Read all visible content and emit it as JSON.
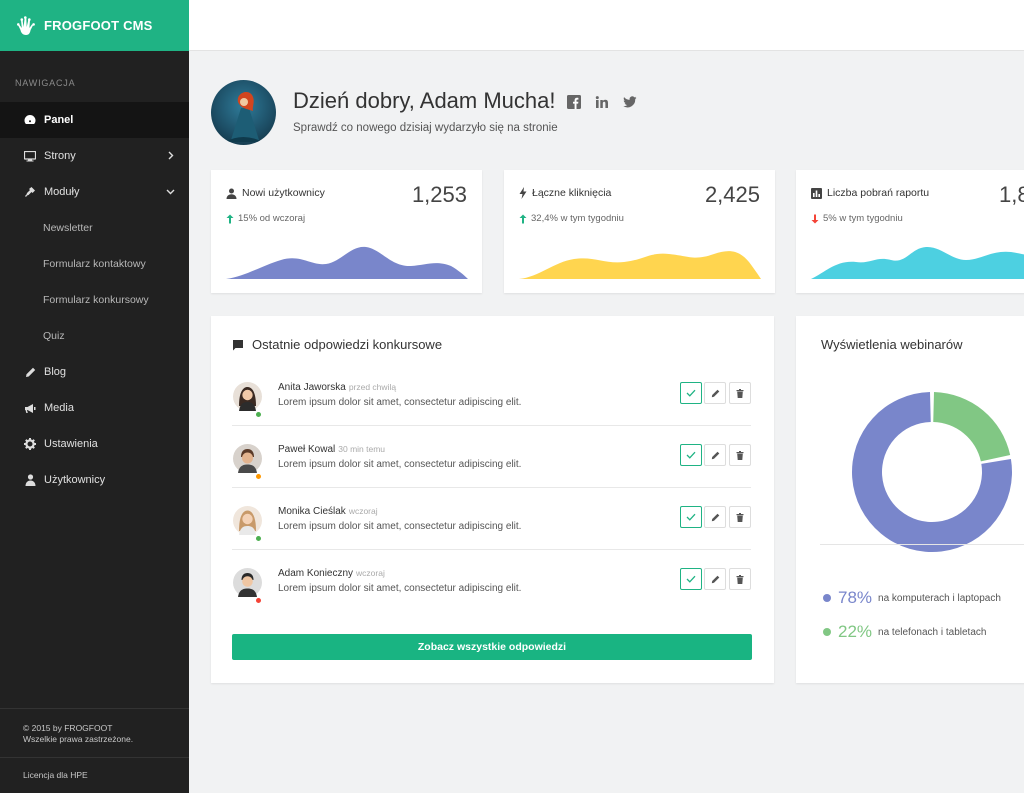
{
  "brand": {
    "name": "FROGFOOT CMS"
  },
  "nav": {
    "heading": "NAWIGACJA",
    "items": [
      {
        "label": "Panel",
        "icon": "dashboard-icon",
        "active": true
      },
      {
        "label": "Strony",
        "icon": "monitor-icon",
        "chevron": "right"
      },
      {
        "label": "Moduły",
        "icon": "plug-icon",
        "chevron": "down"
      },
      {
        "label": "Newsletter",
        "sub": true
      },
      {
        "label": "Formularz kontaktowy",
        "sub": true
      },
      {
        "label": "Formularz konkursowy",
        "sub": true
      },
      {
        "label": "Quiz",
        "sub": true
      },
      {
        "label": "Blog",
        "icon": "pencil-icon"
      },
      {
        "label": "Media",
        "icon": "megaphone-icon"
      },
      {
        "label": "Ustawienia",
        "icon": "gear-icon"
      },
      {
        "label": "Użytkownicy",
        "icon": "user-icon"
      }
    ],
    "footer": {
      "copy1": "© 2015 by FROGFOOT",
      "copy2": "Wszelkie prawa zastrzeżone.",
      "license": "Licencja dla HPE"
    }
  },
  "header": {
    "greeting": "Dzień dobry, Adam Mucha!",
    "subtitle": "Sprawdź co nowego dzisiaj wydarzyło się na stronie"
  },
  "stats": [
    {
      "title": "Nowi użytkownicy",
      "value": "1,253",
      "change": "15% od wczoraj",
      "trend": "up",
      "color": "#7986cb"
    },
    {
      "title": "Łączne kliknięcia",
      "value": "2,425",
      "change": "32,4% w tym tygodniu",
      "trend": "up",
      "color": "#ffd54f"
    },
    {
      "title": "Liczba pobrań raportu",
      "value": "1,8",
      "change": "5% w tym tygodniu",
      "trend": "down",
      "color": "#4dd0e1"
    }
  ],
  "responses": {
    "title": "Ostatnie odpowiedzi konkursowe",
    "items": [
      {
        "name": "Anita Jaworska",
        "time": "przed chwilą",
        "message": "Lorem ipsum dolor sit amet, consectetur adipiscing elit.",
        "status_color": "#4caf50"
      },
      {
        "name": "Paweł Kowal",
        "time": "30 min temu",
        "message": "Lorem ipsum dolor sit amet, consectetur adipiscing elit.",
        "status_color": "#ff9800"
      },
      {
        "name": "Monika Cieślak",
        "time": "wczoraj",
        "message": "Lorem ipsum dolor sit amet, consectetur adipiscing elit.",
        "status_color": "#4caf50"
      },
      {
        "name": "Adam Konieczny",
        "time": "wczoraj",
        "message": "Lorem ipsum dolor sit amet, consectetur adipiscing elit.",
        "status_color": "#f44336"
      }
    ],
    "cta": "Zobacz wszystkie odpowiedzi"
  },
  "webinars": {
    "title": "Wyświetlenia webinarów",
    "chart_data": {
      "type": "pie",
      "categories": [
        "na komputerach i laptopach",
        "na telefonach i tabletach"
      ],
      "values": [
        78,
        22
      ],
      "colors": [
        "#7986cb",
        "#81c784"
      ]
    },
    "legend": [
      {
        "pct": "78%",
        "label": "na komputerach i laptopach",
        "color": "#7986cb"
      },
      {
        "pct": "22%",
        "label": "na telefonach i tabletach",
        "color": "#81c784"
      }
    ]
  },
  "colors": {
    "accent": "#1fb384",
    "sidebar": "#212121"
  }
}
